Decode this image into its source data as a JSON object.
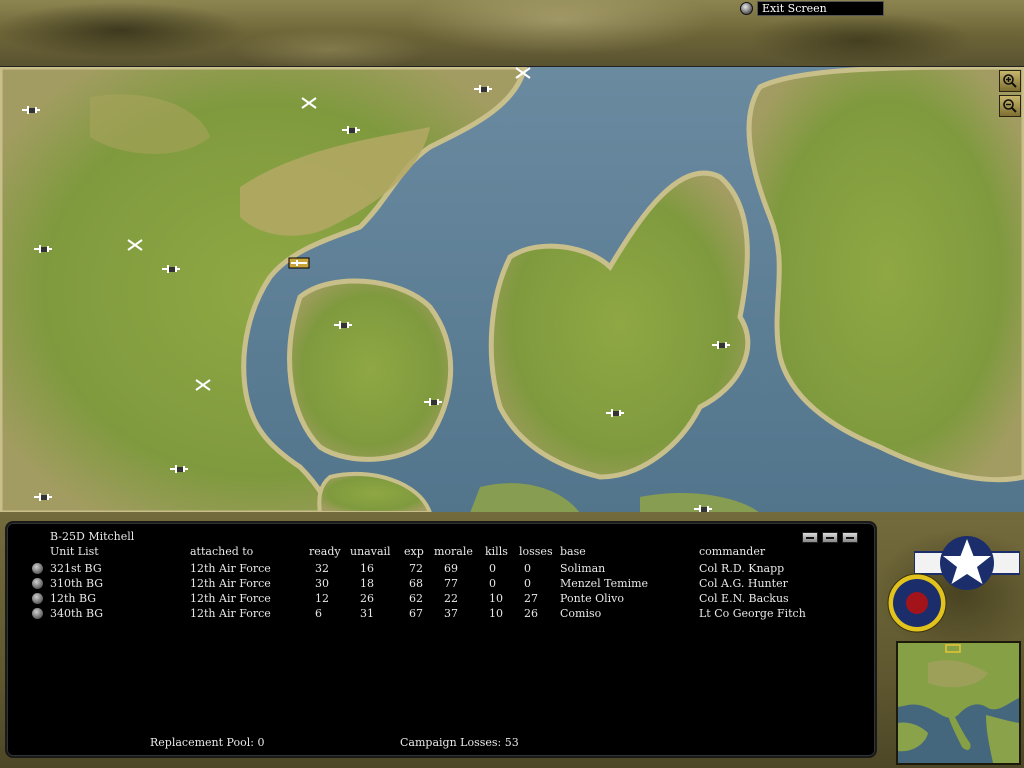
{
  "top_bar": {
    "exit_label": "Exit Screen"
  },
  "map": {
    "zoom_in_icon": "zoom-in-magnifier-icon",
    "zoom_out_icon": "zoom-out-magnifier-icon",
    "colors": {
      "sea": "#5d7f95",
      "land": "#8aa34a",
      "highland": "#b2a561"
    }
  },
  "panel": {
    "aircraft_type": "B-25D Mitchell",
    "headers": {
      "unit_list": "Unit List",
      "attached_to": "attached to",
      "ready": "ready",
      "unavail": "unavail",
      "exp": "exp",
      "morale": "morale",
      "kills": "kills",
      "losses": "losses",
      "base": "base",
      "commander": "commander"
    },
    "units": [
      {
        "name": "321st BG",
        "attached_to": "12th Air Force",
        "ready": "32",
        "unavail": "16",
        "exp": "72",
        "morale": "69",
        "kills": "0",
        "losses": "0",
        "base": "Soliman",
        "commander": "Col R.D. Knapp"
      },
      {
        "name": "310th BG",
        "attached_to": "12th Air Force",
        "ready": "30",
        "unavail": "18",
        "exp": "68",
        "morale": "77",
        "kills": "0",
        "losses": "0",
        "base": "Menzel Temime",
        "commander": "Col A.G. Hunter"
      },
      {
        "name": "12th BG",
        "attached_to": "12th Air Force",
        "ready": "12",
        "unavail": "26",
        "exp": "62",
        "morale": "22",
        "kills": "10",
        "losses": "27",
        "base": "Ponte Olivo",
        "commander": "Col E.N. Backus"
      },
      {
        "name": "340th BG",
        "attached_to": "12th Air Force",
        "ready": "6",
        "unavail": "31",
        "exp": "67",
        "morale": "37",
        "kills": "10",
        "losses": "26",
        "base": "Comiso",
        "commander": "Lt Co George Fitch"
      }
    ],
    "replacement_pool_label": "Replacement Pool: 0",
    "campaign_losses_label": "Campaign Losses: 53"
  },
  "insignia": {
    "roundel_icon": "raf-roundel-icon",
    "star_icon": "usaaf-star-insignia-icon"
  },
  "minimap": {
    "icon": "europe-minimap"
  }
}
